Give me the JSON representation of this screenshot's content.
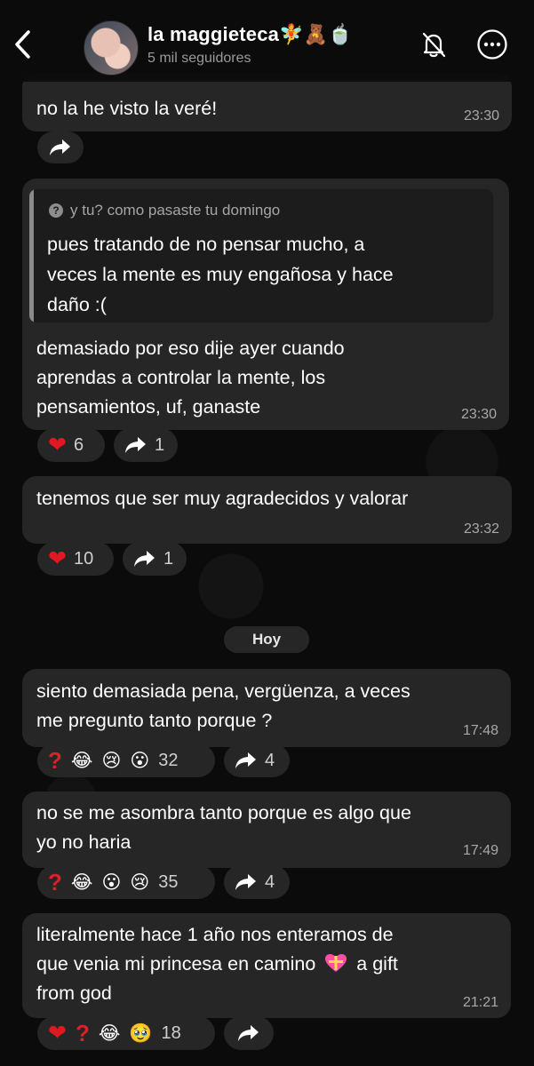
{
  "header": {
    "title": "la maggieteca🧚🧸🍵",
    "subtitle": "5 mil seguidores"
  },
  "messages": [
    {
      "text_lines": [
        "no la he visto la veré!"
      ],
      "time": "23:30"
    },
    {
      "quote_label": "y tu? como pasaste tu domingo",
      "quote_lines": [
        "pues tratando de no pensar mucho, a",
        "veces la mente es  muy engañosa y hace",
        "daño :("
      ],
      "text_lines": [
        "demasiado por eso dije ayer cuando",
        "aprendas a controlar la mente, los",
        "pensamientos, uf, ganaste"
      ],
      "time": "23:30",
      "reaction_count": "6",
      "forward_count": "1"
    },
    {
      "text_lines": [
        "tenemos que ser muy agradecidos y valorar"
      ],
      "time": "23:32",
      "reaction_count": "10",
      "forward_count": "1"
    },
    {
      "text_lines": [
        "siento demasiada pena, vergüenza, a veces",
        "me pregunto tanto porque ?"
      ],
      "time": "17:48",
      "reaction_count": "32",
      "forward_count": "4"
    },
    {
      "text_lines": [
        "no se me asombra tanto porque es algo que",
        "yo no haria"
      ],
      "time": "17:49",
      "reaction_count": "35",
      "forward_count": "4"
    },
    {
      "text_lines": [
        "literalmente hace 1 año nos enteramos de",
        "que venia mi princesa en camino",
        "from god"
      ],
      "text_line2_tail": "a gift",
      "time": "21:21",
      "reaction_count": "18"
    }
  ],
  "day_separator": "Hoy",
  "icons": {
    "back": "chevron-left-icon",
    "mute": "bell-slash-icon",
    "more": "more-horizontal-icon",
    "forward": "forward-arrow-icon"
  },
  "colors": {
    "bubble": "#262626",
    "background": "#0b0b0b",
    "heart": "#e0181f"
  }
}
